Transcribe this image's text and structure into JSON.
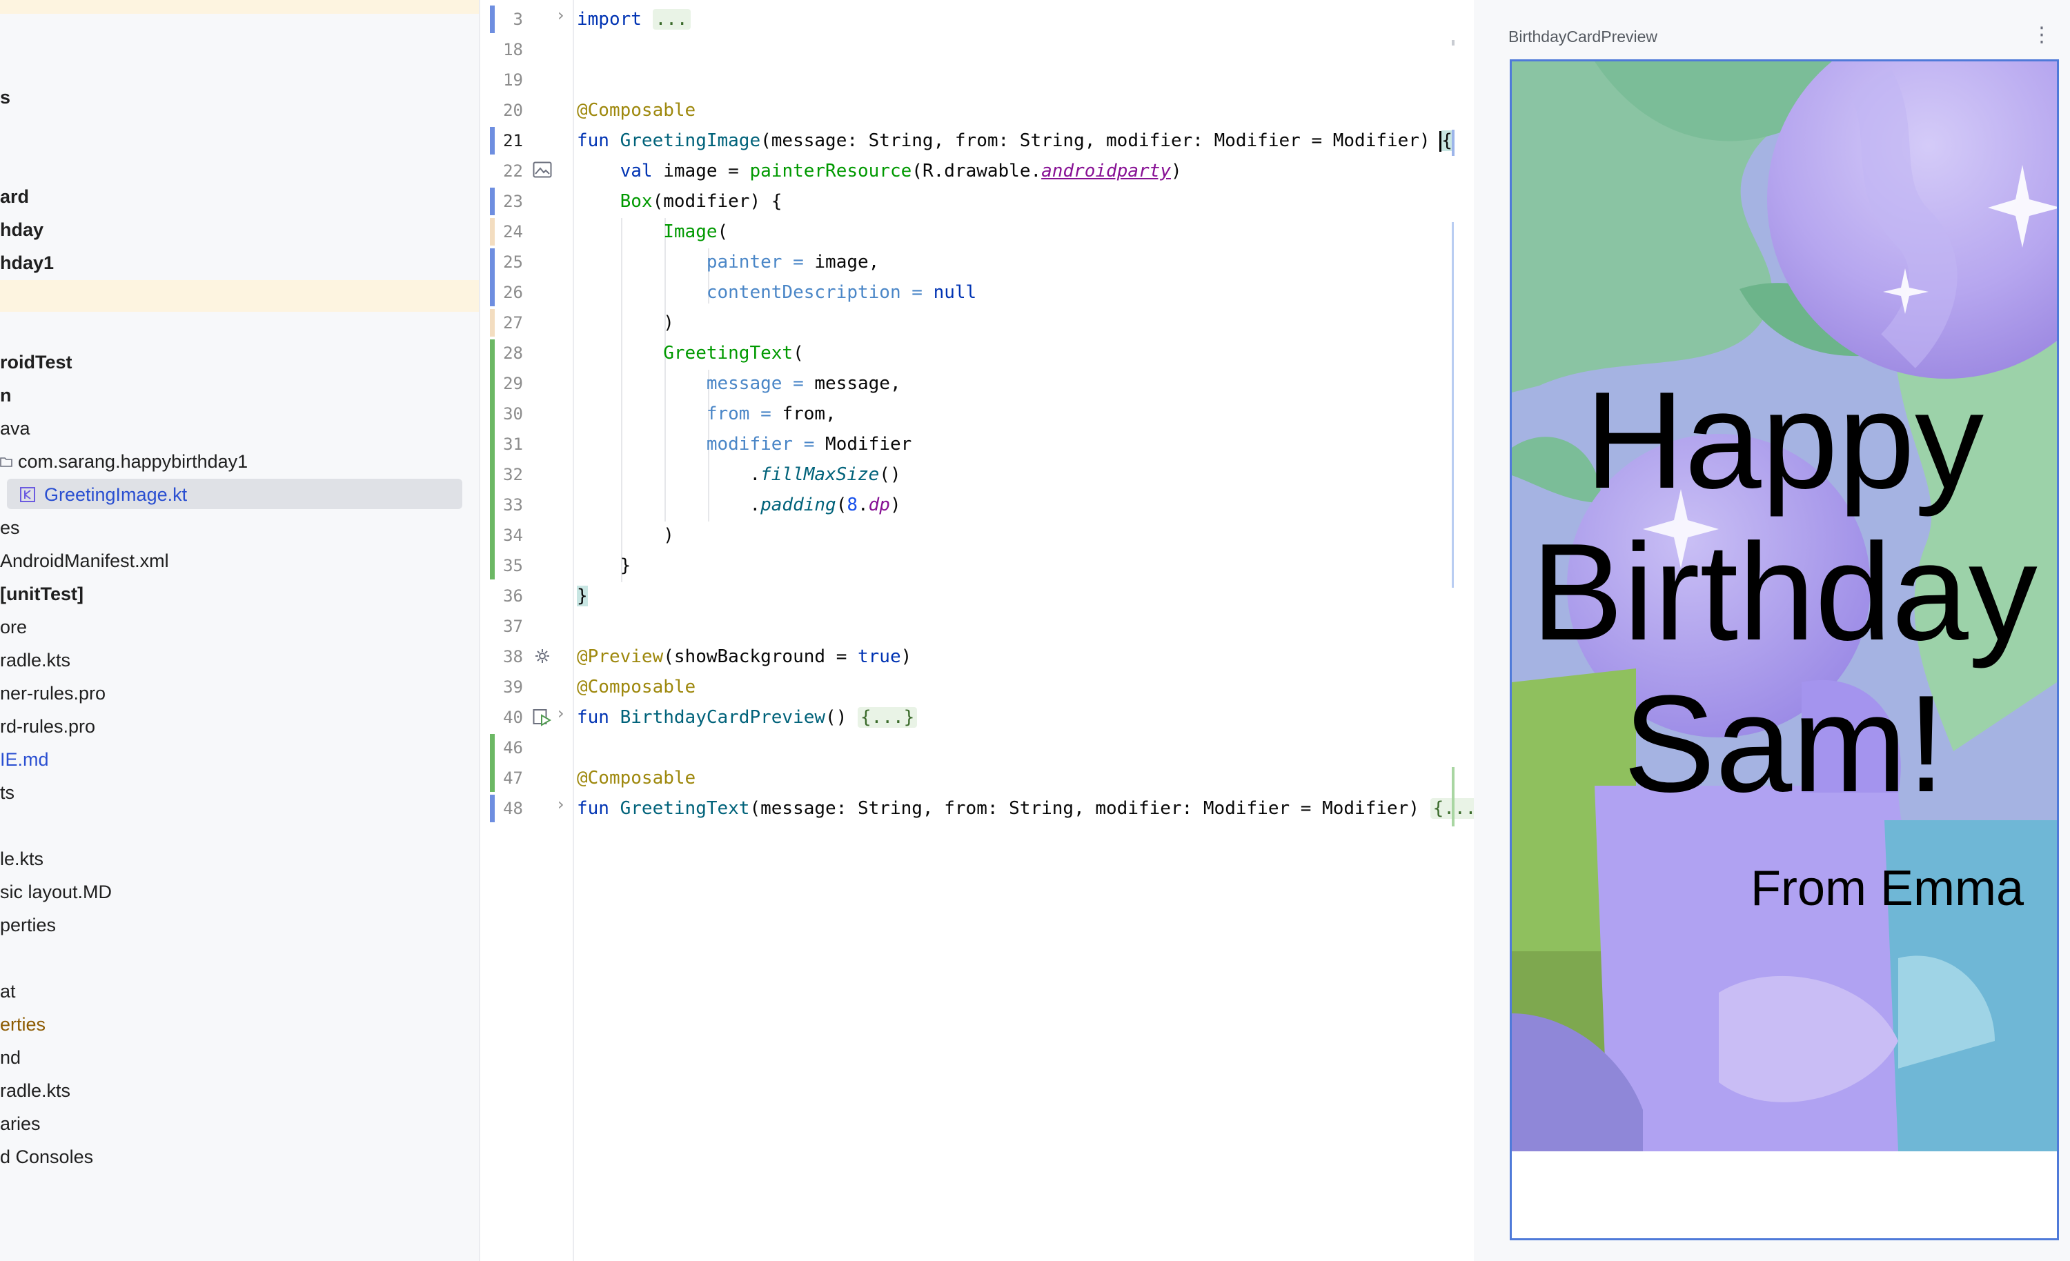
{
  "project_tree": {
    "items": [
      {
        "label": "s",
        "style": "bold"
      },
      {
        "label": "ard",
        "style": "bold"
      },
      {
        "label": "hday",
        "style": "bold"
      },
      {
        "label": "hday1",
        "style": "bold"
      },
      {
        "label": "roidTest",
        "style": "bold"
      },
      {
        "label": "n",
        "style": "bold"
      },
      {
        "label": "ava",
        "style": "normal"
      },
      {
        "label": "com.sarang.happybirthday1",
        "style": "normal"
      },
      {
        "label": "GreetingImage.kt",
        "style": "blue"
      },
      {
        "label": "es",
        "style": "normal"
      },
      {
        "label": "AndroidManifest.xml",
        "style": "normal"
      },
      {
        "label": " [unitTest]",
        "style": "bold"
      },
      {
        "label": "ore",
        "style": "normal"
      },
      {
        "label": "radle.kts",
        "style": "normal"
      },
      {
        "label": "ner-rules.pro",
        "style": "normal"
      },
      {
        "label": "rd-rules.pro",
        "style": "normal"
      },
      {
        "label": "IE.md",
        "style": "blue"
      },
      {
        "label": "ts",
        "style": "normal"
      },
      {
        "label": "le.kts",
        "style": "normal"
      },
      {
        "label": "sic layout.MD",
        "style": "normal"
      },
      {
        "label": "perties",
        "style": "normal"
      },
      {
        "label": "at",
        "style": "normal"
      },
      {
        "label": "erties",
        "style": "brown"
      },
      {
        "label": "nd",
        "style": "normal"
      },
      {
        "label": "radle.kts",
        "style": "normal"
      },
      {
        "label": "aries",
        "style": "normal"
      },
      {
        "label": "d Consoles",
        "style": "normal"
      }
    ]
  },
  "editor": {
    "line_numbers": [
      "3",
      "18",
      "19",
      "20",
      "21",
      "22",
      "23",
      "24",
      "25",
      "26",
      "27",
      "28",
      "29",
      "30",
      "31",
      "32",
      "33",
      "34",
      "35",
      "36",
      "37",
      "38",
      "39",
      "40",
      "46",
      "47",
      "48"
    ],
    "active_line": "21",
    "code": {
      "l3_kw": "import",
      "l3_fold": "...",
      "l20": "@Composable",
      "l21_kw": "fun",
      "l21_fn": "GreetingImage",
      "l21_rest": "(message: String, from: String, modifier: Modifier = Modifier) ",
      "l21_brace": "{",
      "l22_kw": "val",
      "l22_a": " image = ",
      "l22_fn": "painterResource",
      "l22_b": "(R.drawable.",
      "l22_res": "androidparty",
      "l22_c": ")",
      "l23_fn": "Box",
      "l23_rest": "(modifier) {",
      "l24_fn": "Image",
      "l24_rest": "(",
      "l25_prm": "painter",
      "l25_eq": " = ",
      "l25_rest": "image,",
      "l26_prm": "contentDescription",
      "l26_eq": " = ",
      "l26_kw": "null",
      "l27": ")",
      "l28_fn": "GreetingText",
      "l28_rest": "(",
      "l29_prm": "message",
      "l29_eq": " = ",
      "l29_rest": "message,",
      "l30_prm": "from",
      "l30_eq": " = ",
      "l30_rest": "from,",
      "l31_prm": "modifier",
      "l31_eq": " = ",
      "l31_rest": "Modifier",
      "l32_dot": ".",
      "l32_fn": "fillMaxSize",
      "l32_rest": "()",
      "l33_dot": ".",
      "l33_fn": "padding",
      "l33_p1": "(",
      "l33_num": "8",
      "l33_dot2": ".",
      "l33_unit": "dp",
      "l33_p2": ")",
      "l34": ")",
      "l35": "}",
      "l36": "}",
      "l38_ann": "@Preview",
      "l38_a": "(showBackground = ",
      "l38_kw": "true",
      "l38_b": ")",
      "l39": "@Composable",
      "l40_kw": "fun",
      "l40_fn": "BirthdayCardPreview",
      "l40_rest": "() ",
      "l40_fold": "{...}",
      "l47": "@Composable",
      "l48_kw": "fun",
      "l48_fn": "GreetingText",
      "l48_rest": "(message: String, from: String, modifier: Modifier = Modifier) ",
      "l48_fold": "{..."
    }
  },
  "preview": {
    "title": "BirthdayCardPreview",
    "more_icon": "⋮",
    "greeting_lines": [
      "Happy",
      "Birthday",
      "Sam!"
    ],
    "from": "From Emma"
  },
  "colors": {
    "accent": "#4f7ad9",
    "vcs_modified": "#6e8ee0",
    "vcs_added": "#6cb864"
  }
}
